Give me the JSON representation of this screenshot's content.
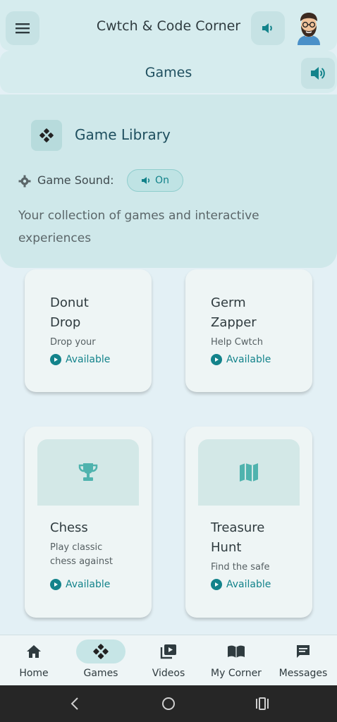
{
  "header": {
    "title": "Cwtch & Code Corner",
    "menu_icon": "menu-icon",
    "sound_icon": "volume-icon",
    "avatar": "bearded-man-avatar"
  },
  "subheader": {
    "title": "Games",
    "sound_icon": "volume-icon"
  },
  "library": {
    "title": "Game Library",
    "icon": "gamepad-icon",
    "sound_label": "Game Sound:",
    "sound_toggle": "On",
    "description_line1": "Your collection of games and interactive",
    "description_line2": "experiences"
  },
  "games": [
    {
      "title_line1": "Donut",
      "title_line2": "Drop",
      "desc_line1": "Drop your",
      "desc_line2": "",
      "status": "Available",
      "icon": ""
    },
    {
      "title_line1": "Germ",
      "title_line2": "Zapper",
      "desc_line1": "Help Cwtch",
      "desc_line2": "",
      "status": "Available",
      "icon": ""
    },
    {
      "title_line1": "Chess",
      "title_line2": "",
      "desc_line1": "Play classic",
      "desc_line2": "chess against",
      "status": "Available",
      "icon": "trophy-icon"
    },
    {
      "title_line1": "Treasure",
      "title_line2": "Hunt",
      "desc_line1": "Find the safe",
      "desc_line2": "",
      "status": "Available",
      "icon": "map-icon"
    }
  ],
  "nav": [
    {
      "label": "Home",
      "icon": "home-icon",
      "active": false
    },
    {
      "label": "Games",
      "icon": "gamepad-icon",
      "active": true
    },
    {
      "label": "Videos",
      "icon": "video-library-icon",
      "active": false
    },
    {
      "label": "My Corner",
      "icon": "book-icon",
      "active": false
    },
    {
      "label": "Messages",
      "icon": "message-icon",
      "active": false
    }
  ],
  "colors": {
    "accent": "#13838b",
    "background": "#e3f0f5",
    "header": "#d6ecee",
    "card": "#eef5f5"
  }
}
